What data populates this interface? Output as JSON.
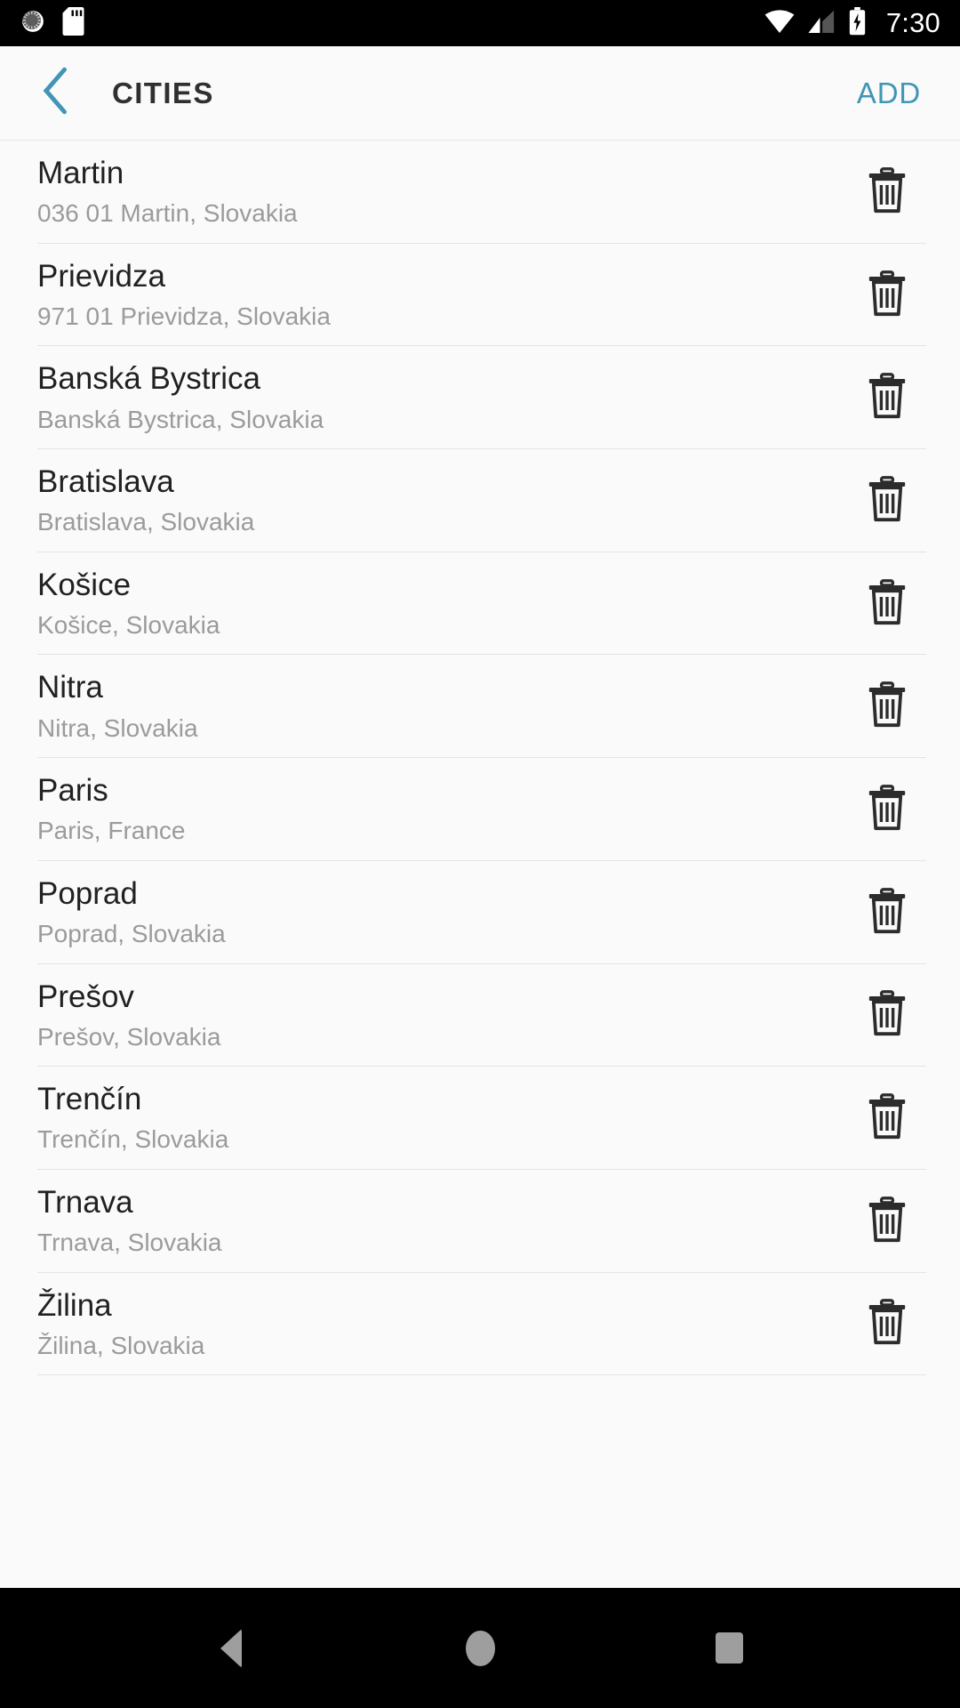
{
  "status_bar": {
    "icons_left": [
      "sync-circle-icon",
      "sd-card-icon"
    ],
    "icons_right": [
      "wifi-icon",
      "cell-signal-icon",
      "battery-charging-icon"
    ],
    "time": "7:30"
  },
  "app_bar": {
    "back_icon": "chevron-left-icon",
    "title": "CITIES",
    "add_label": "ADD",
    "accent_color": "#4195b5",
    "title_color": "#2f3031",
    "background": "#fafafa"
  },
  "list": {
    "delete_icon": "trash-icon",
    "items": [
      {
        "name": "Martin",
        "subtitle": "036 01 Martin, Slovakia"
      },
      {
        "name": "Prievidza",
        "subtitle": "971 01 Prievidza, Slovakia"
      },
      {
        "name": "Banská Bystrica",
        "subtitle": "Banská Bystrica, Slovakia"
      },
      {
        "name": "Bratislava",
        "subtitle": "Bratislava, Slovakia"
      },
      {
        "name": "Košice",
        "subtitle": "Košice, Slovakia"
      },
      {
        "name": "Nitra",
        "subtitle": "Nitra, Slovakia"
      },
      {
        "name": "Paris",
        "subtitle": "Paris, France"
      },
      {
        "name": "Poprad",
        "subtitle": "Poprad, Slovakia"
      },
      {
        "name": "Prešov",
        "subtitle": "Prešov, Slovakia"
      },
      {
        "name": "Trenčín",
        "subtitle": "Trenčín, Slovakia"
      },
      {
        "name": "Trnava",
        "subtitle": "Trnava, Slovakia"
      },
      {
        "name": "Žilina",
        "subtitle": "Žilina, Slovakia"
      }
    ]
  },
  "nav_bar": {
    "buttons": [
      "back-triangle-icon",
      "home-circle-icon",
      "recents-square-icon"
    ],
    "icon_color": "#9e9e9e",
    "background": "#000000"
  }
}
